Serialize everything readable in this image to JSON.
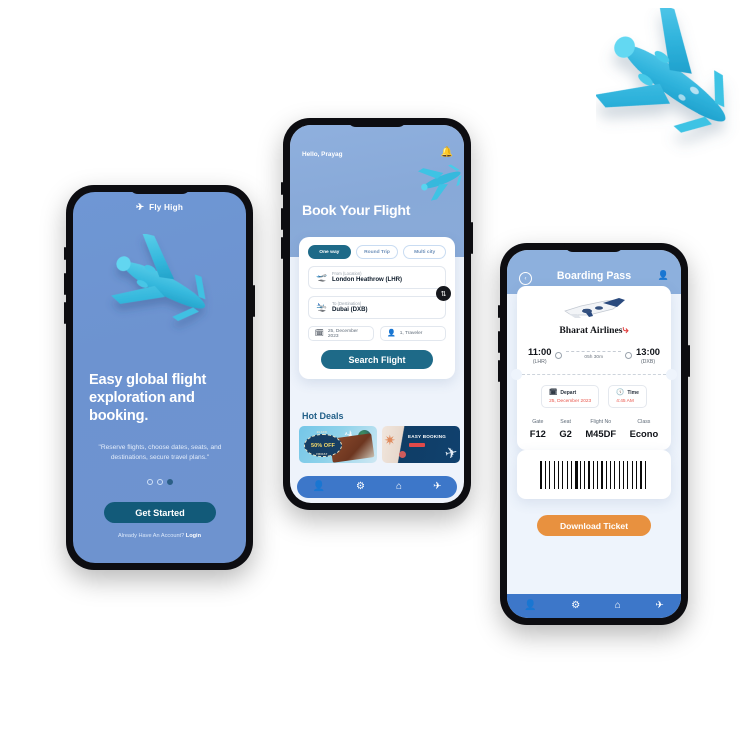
{
  "onboarding": {
    "logo_text": "Fly High",
    "logo_icon": "airplane-icon",
    "headline": "Easy global flight exploration and booking.",
    "subtext": "\"Reserve flights, choose dates, seats, and destinations, secure travel plans.\"",
    "cta_label": "Get Started",
    "login_prefix": "Already Have An Account? ",
    "login_link": "Login",
    "dots": 3,
    "active_dot": 3,
    "bg_color": "#6e93d0",
    "cta_color": "#125a79"
  },
  "booking": {
    "greeting": "Hello, Prayag",
    "bell_icon": "notification-bell-icon",
    "title": "Book Your Flight",
    "trip_tabs": [
      {
        "label": "One way",
        "selected": true
      },
      {
        "label": "Round Trip",
        "selected": false
      },
      {
        "label": "Multi city",
        "selected": false
      }
    ],
    "from": {
      "label": "From (Location)",
      "value": "London Heathrow (LHR)",
      "icon": "plane-departure-icon"
    },
    "to": {
      "label": "To (Destination)",
      "value": "Dubai (DXB)",
      "icon": "plane-arrival-icon"
    },
    "swap_icon": "swap-vertical-icon",
    "date": {
      "value": "25, December 2023",
      "icon": "calendar-icon"
    },
    "travelers": {
      "value": "1, Traveler",
      "icon": "person-icon"
    },
    "search_label": "Search Flight",
    "deals_title": "Hot Deals",
    "deals": [
      {
        "badge": "50% OFF",
        "badge_top": "BLACK",
        "badge_bottom": "FRIDAY",
        "name": "black-friday-deal"
      },
      {
        "badge": "EASY BOOKING",
        "name": "easy-booking-deal"
      }
    ],
    "nav": [
      {
        "icon": "person-icon",
        "glyph": "👤",
        "name": "profile"
      },
      {
        "icon": "gear-icon",
        "glyph": "⚙",
        "name": "settings"
      },
      {
        "icon": "home-icon",
        "glyph": "⌂",
        "name": "home"
      },
      {
        "icon": "airplane-icon",
        "glyph": "✈",
        "name": "flights"
      }
    ],
    "accent_color": "#1e6a88",
    "nav_color": "#3d77c9"
  },
  "boarding_pass": {
    "back_icon": "back-arrow-icon",
    "title": "Boarding Pass",
    "user_icon": "person-icon",
    "airline": "Bharat Airlines",
    "airline_plane_icon": "airliner-icon",
    "depart_time": "11:00",
    "depart_code": "(LHR)",
    "arrive_time": "13:00",
    "arrive_code": "(DXB)",
    "duration": "05h 30m",
    "mid_icon": "airplane-icon",
    "depart_box": {
      "label": "Depart",
      "value": "25, December 2023",
      "icon": "calendar-icon"
    },
    "time_box": {
      "label": "Time",
      "value": "4:45 AM",
      "icon": "clock-icon"
    },
    "details": [
      {
        "key": "Gate",
        "value": "F12"
      },
      {
        "key": "Seat",
        "value": "G2"
      },
      {
        "key": "Flight No",
        "value": "M45DF"
      },
      {
        "key": "Class",
        "value": "Econo"
      }
    ],
    "barcode_name": "barcode",
    "download_label": "Download Ticket",
    "download_color": "#e8913f",
    "nav": [
      {
        "icon": "person-icon",
        "glyph": "👤",
        "name": "profile"
      },
      {
        "icon": "gear-icon",
        "glyph": "⚙",
        "name": "settings"
      },
      {
        "icon": "home-icon",
        "glyph": "⌂",
        "name": "home"
      },
      {
        "icon": "airplane-icon",
        "glyph": "✈",
        "name": "flights"
      }
    ],
    "header_color": "#8db0dd"
  },
  "decor": {
    "big_plane_icon": "airplane-3d-illustration",
    "big_plane_color": "#2fb3dc"
  }
}
